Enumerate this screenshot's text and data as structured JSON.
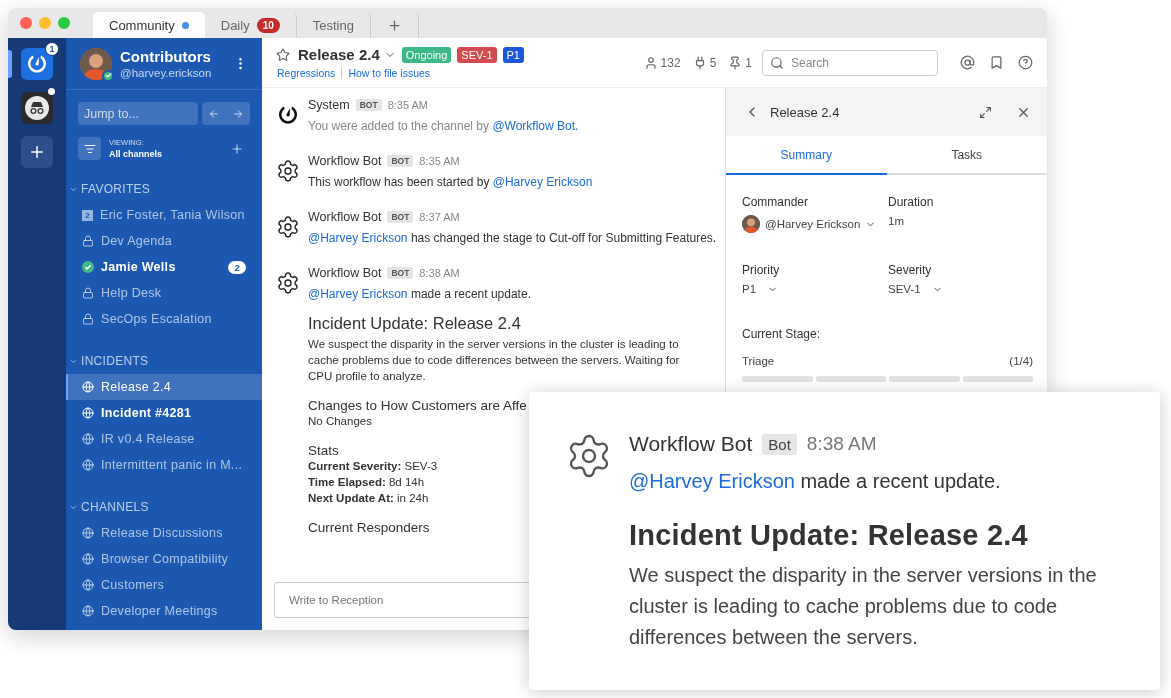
{
  "tabs": [
    {
      "label": "Community",
      "selected": true,
      "unread_dot": true
    },
    {
      "label": "Daily",
      "selected": false,
      "badge": "10"
    },
    {
      "label": "Testing",
      "selected": false
    }
  ],
  "teams": [
    {
      "kind": "logo",
      "selected": true,
      "badge": "1"
    },
    {
      "kind": "incognito",
      "selected": false,
      "unread_dot": true
    }
  ],
  "sidebar": {
    "team_name": "Contributors",
    "username": "@harvey.erickson",
    "jump_placeholder": "Jump to...",
    "viewing_label": "VIEWING:",
    "viewing_value": "All channels",
    "sections": [
      {
        "title": "FAVORITES",
        "expanded": true,
        "items": [
          {
            "kind": "group",
            "label": "Eric Foster, Tania Wilson",
            "count": "2",
            "unread": false,
            "selected": false
          },
          {
            "kind": "private",
            "label": "Dev Agenda",
            "unread": false,
            "selected": false
          },
          {
            "kind": "online",
            "label": "Jamie Wells",
            "unread": true,
            "selected": false,
            "badge": "2"
          },
          {
            "kind": "private",
            "label": "Help Desk",
            "unread": false,
            "selected": false
          },
          {
            "kind": "private",
            "label": "SecOps Escalation",
            "unread": false,
            "selected": false
          }
        ]
      },
      {
        "title": "INCIDENTS",
        "expanded": true,
        "items": [
          {
            "kind": "public",
            "label": "Release 2.4",
            "unread": false,
            "selected": true
          },
          {
            "kind": "public",
            "label": "Incident #4281",
            "unread": true,
            "selected": false
          },
          {
            "kind": "public",
            "label": "IR v0.4 Release",
            "unread": false,
            "selected": false
          },
          {
            "kind": "public",
            "label": "Intermittent panic in M...",
            "unread": false,
            "selected": false
          }
        ]
      },
      {
        "title": "CHANNELS",
        "expanded": true,
        "items": [
          {
            "kind": "public",
            "label": "Release Discussions",
            "unread": false,
            "selected": false
          },
          {
            "kind": "public",
            "label": "Browser Compatibility",
            "unread": false,
            "selected": false
          },
          {
            "kind": "public",
            "label": "Customers",
            "unread": false,
            "selected": false
          },
          {
            "kind": "public",
            "label": "Developer Meetings",
            "unread": false,
            "selected": false
          }
        ]
      }
    ]
  },
  "header": {
    "channel": "Release 2.4",
    "favorite": false,
    "tags": [
      {
        "label": "Ongoing",
        "color": "#3db887"
      },
      {
        "label": "SEV-1",
        "color": "#d24b4e"
      },
      {
        "label": "P1",
        "color": "#1c58d9"
      }
    ],
    "links": [
      "Regressions",
      "How to file issues"
    ],
    "stats": [
      {
        "kind": "members",
        "value": "132"
      },
      {
        "kind": "plugins",
        "value": "5"
      },
      {
        "kind": "pinned",
        "value": "1"
      }
    ],
    "search_placeholder": "Search"
  },
  "messages": [
    {
      "kind": "system",
      "author": "System",
      "badge": "BOT",
      "time": "8:35 AM",
      "parts": [
        {
          "kind": "text",
          "text": "You were added to the channel by "
        },
        {
          "kind": "mention",
          "text": "@Workflow Bot."
        }
      ]
    },
    {
      "kind": "bot",
      "author": "Workflow Bot",
      "badge": "BOT",
      "time": "8:35 AM",
      "parts": [
        {
          "kind": "text",
          "text": "This workflow has been started by "
        },
        {
          "kind": "mention",
          "text": "@Harvey Erickson"
        }
      ]
    },
    {
      "kind": "bot",
      "author": "Workflow Bot",
      "badge": "BOT",
      "time": "8:37 AM",
      "parts": [
        {
          "kind": "mention",
          "text": "@Harvey Erickson"
        },
        {
          "kind": "text",
          "text": " has changed the stage to Cut-off for Submitting Features."
        }
      ]
    },
    {
      "kind": "bot",
      "author": "Workflow Bot",
      "badge": "BOT",
      "time": "8:38 AM",
      "parts": [
        {
          "kind": "mention",
          "text": "@Harvey Erickson"
        },
        {
          "kind": "text",
          "text": " made a recent update."
        }
      ],
      "update": {
        "title": "Incident Update: Release 2.4",
        "body": "We suspect the disparity in the server versions in the cluster is leading to cache problems due to code differences between the servers. Waiting for CPU profile to analyze.",
        "sections": [
          {
            "heading": "Changes to How Customers are Affe",
            "lines": [
              "No Changes"
            ]
          },
          {
            "heading": "Stats",
            "lines": [
              "**Current Severity:** SEV-3",
              "**Time Elapsed:** 8d 14h",
              "**Next Update At:** in 24h"
            ]
          },
          {
            "heading": "Current Responders"
          }
        ]
      }
    }
  ],
  "composer": {
    "placeholder": "Write to Reception"
  },
  "rhs": {
    "title": "Release 2.4",
    "tabs": [
      {
        "label": "Summary",
        "selected": true
      },
      {
        "label": "Tasks",
        "selected": false
      }
    ],
    "fields": [
      {
        "label": "Commander",
        "value": "@Harvey Erickson",
        "kind": "user"
      },
      {
        "label": "Duration",
        "value": "1m",
        "kind": "plain"
      },
      {
        "label": "Priority",
        "value": "P1",
        "kind": "select"
      },
      {
        "label": "Severity",
        "value": "SEV-1",
        "kind": "select"
      }
    ],
    "stage_label": "Current Stage:",
    "stage": "Triage",
    "stage_count": "(1/4)"
  },
  "zoom_card": {
    "author": "Workflow Bot",
    "badge": "Bot",
    "time": "8:38 AM",
    "parts": [
      {
        "kind": "mention",
        "text": "@Harvey Erickson"
      },
      {
        "kind": "text",
        "text": " made a recent update."
      }
    ],
    "title": "Incident Update: Release 2.4",
    "body": "We suspect the disparity in the server versions in the cluster is leading to cache problems due to code differences between the servers."
  }
}
